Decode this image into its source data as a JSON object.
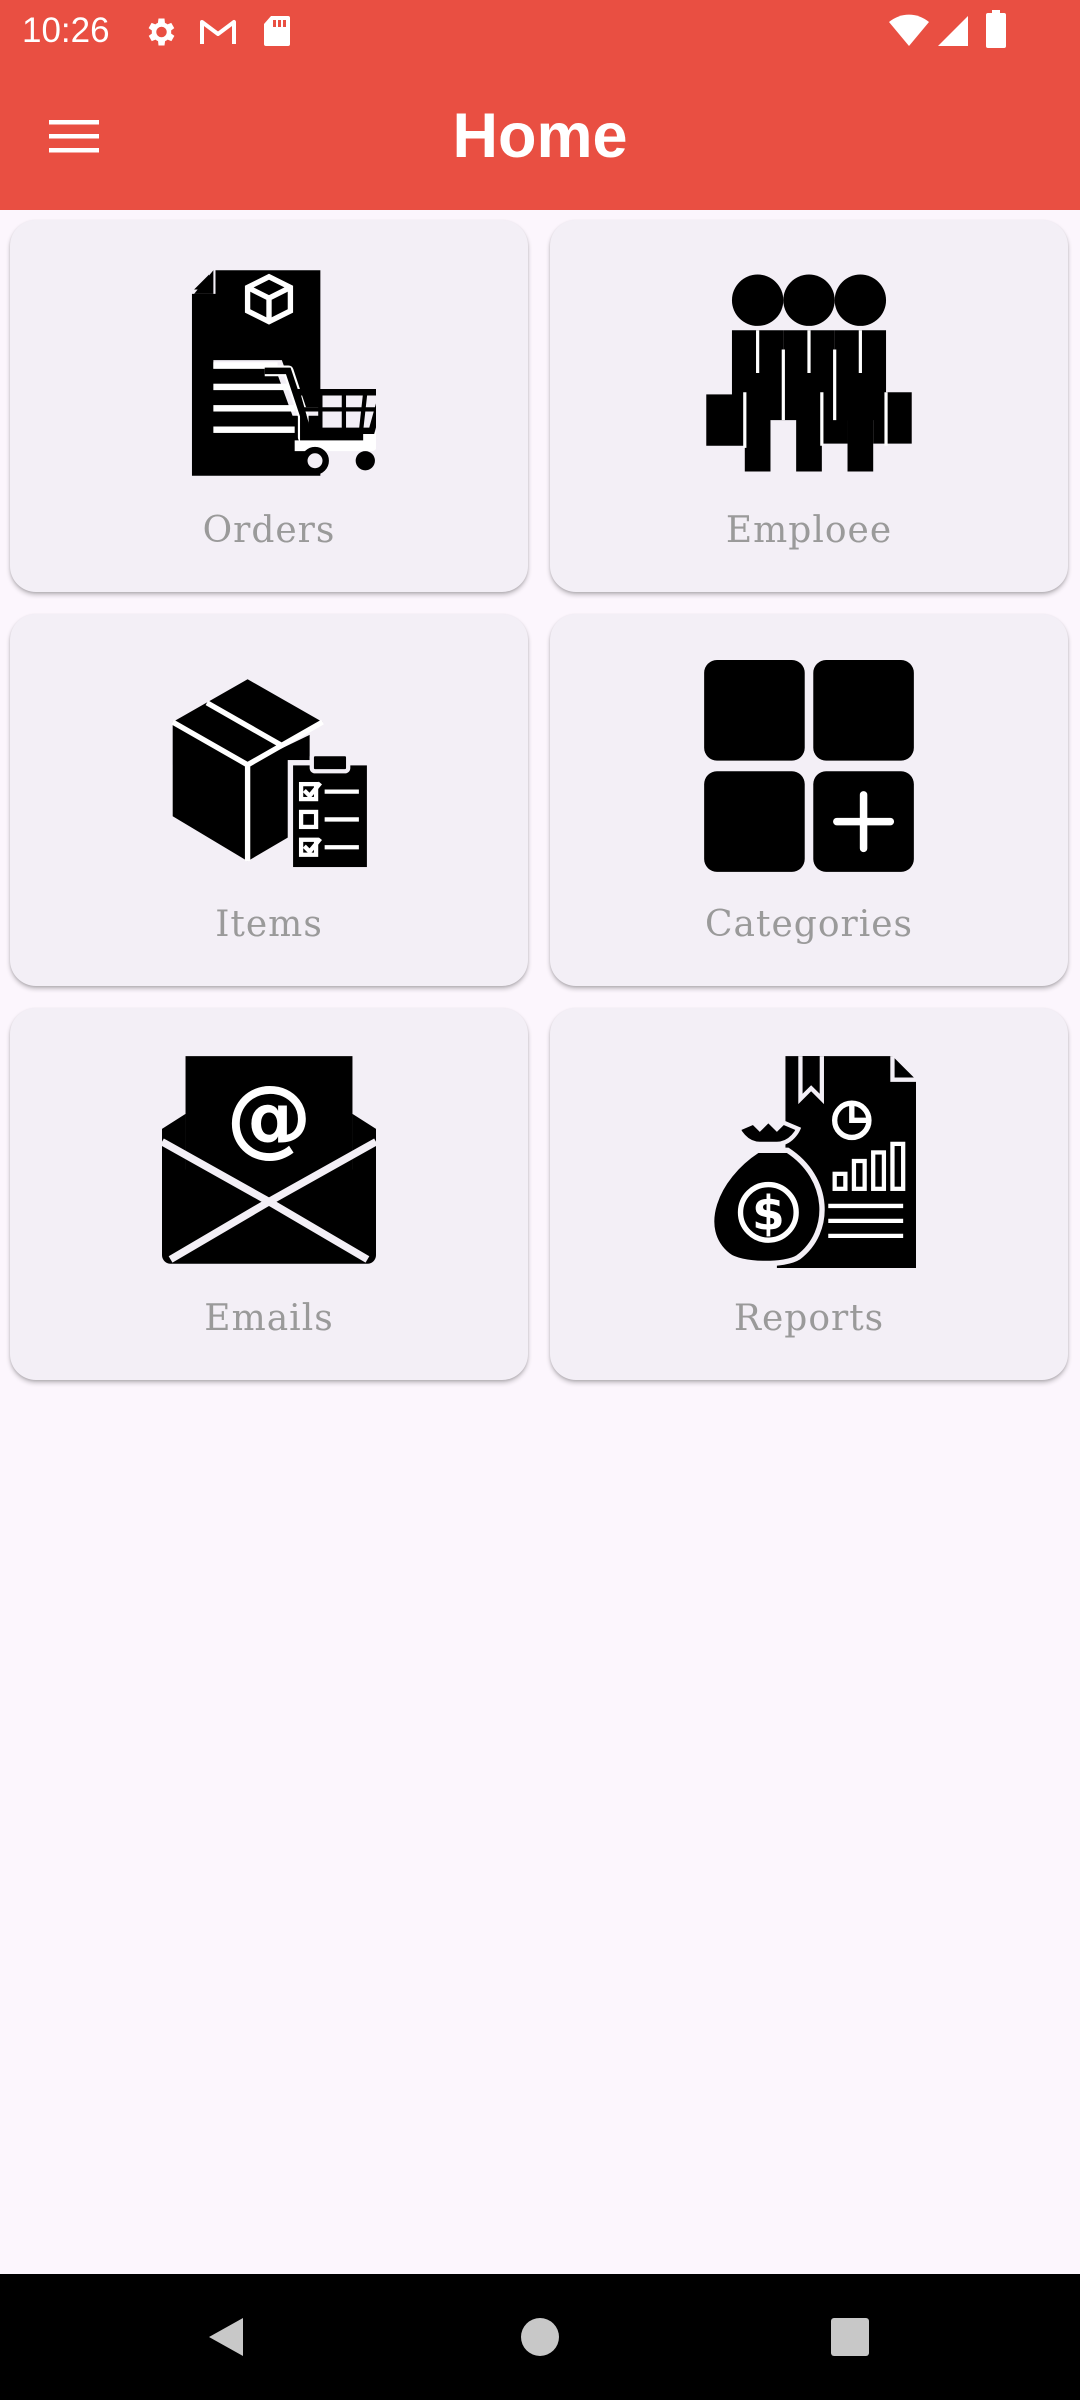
{
  "status_bar": {
    "time": "10:26",
    "left_icons": [
      "gear-icon",
      "gmail-icon",
      "sd-card-icon"
    ],
    "right_icons": [
      "wifi-icon",
      "signal-icon",
      "battery-icon"
    ]
  },
  "app_bar": {
    "title": "Home",
    "menu_icon": "hamburger-menu-icon",
    "background_color": "#e94f42"
  },
  "tiles": [
    {
      "label": "Orders",
      "icon": "order-invoice-cart-icon"
    },
    {
      "label": "Emploee",
      "icon": "employees-group-icon"
    },
    {
      "label": "Items",
      "icon": "box-checklist-icon"
    },
    {
      "label": "Categories",
      "icon": "grid-add-category-icon"
    },
    {
      "label": "Emails",
      "icon": "email-envelope-at-icon"
    },
    {
      "label": "Reports",
      "icon": "money-bag-report-icon"
    }
  ],
  "nav_bar": {
    "buttons": [
      "back-icon",
      "home-icon",
      "recents-icon"
    ]
  }
}
